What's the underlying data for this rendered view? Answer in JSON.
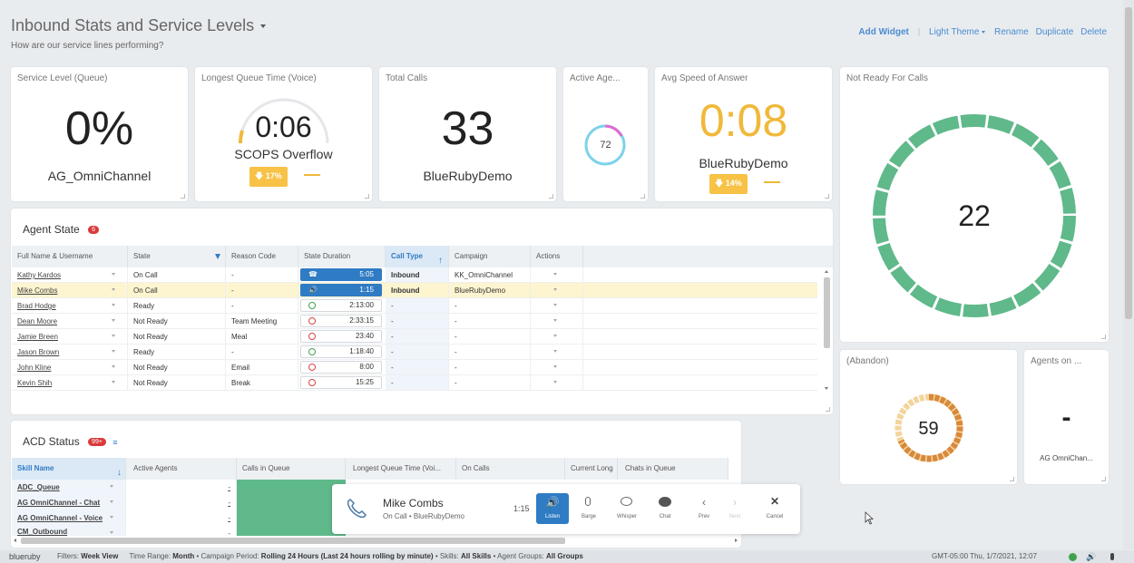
{
  "header": {
    "title": "Inbound Stats and Service Levels",
    "subtitle": "How are our service lines performing?",
    "actions": {
      "add_widget": "Add Widget",
      "theme": "Light Theme",
      "rename": "Rename",
      "duplicate": "Duplicate",
      "delete": "Delete"
    }
  },
  "widgets": {
    "service_level": {
      "title": "Service Level (Queue)",
      "value": "0%",
      "label": "AG_OmniChannel"
    },
    "longest_queue": {
      "title": "Longest Queue Time (Voice)",
      "value": "0:06",
      "label": "SCOPS Overflow",
      "trend": "17%"
    },
    "total_calls": {
      "title": "Total Calls",
      "value": "33",
      "label": "BlueRubyDemo"
    },
    "active_agents": {
      "title": "Active Age...",
      "value": "72"
    },
    "avg_speed": {
      "title": "Avg Speed of Answer",
      "value": "0:08",
      "label": "BlueRubyDemo",
      "trend": "14%"
    },
    "not_ready": {
      "title": "Not Ready For Calls",
      "value": "22"
    },
    "abandon": {
      "title": "(Abandon)",
      "value": "59"
    },
    "agents_on": {
      "title": "Agents on ...",
      "value": "-",
      "label": "AG OmniChan..."
    }
  },
  "agent_state": {
    "title": "Agent State",
    "badge": "6",
    "columns": [
      "Full Name & Username",
      "State",
      "Reason Code",
      "State Duration",
      "Call Type",
      "Campaign",
      "Actions"
    ],
    "rows": [
      {
        "name": "Kathy Kardos",
        "state": "On Call",
        "reason": "-",
        "duration": "5:05",
        "call_type": "Inbound",
        "campaign": "KK_OmniChannel",
        "icon": "phone",
        "highlight": false
      },
      {
        "name": "Mike Combs",
        "state": "On Call",
        "reason": "-",
        "duration": "1:15",
        "call_type": "Inbound",
        "campaign": "BlueRubyDemo",
        "icon": "speaker",
        "highlight": true
      },
      {
        "name": "Brad Hodge",
        "state": "Ready",
        "reason": "-",
        "duration": "2:13:00",
        "call_type": "-",
        "campaign": "-",
        "icon": "ok",
        "highlight": false
      },
      {
        "name": "Dean Moore",
        "state": "Not Ready",
        "reason": "Team Meeting",
        "duration": "2:33:15",
        "call_type": "-",
        "campaign": "-",
        "icon": "x",
        "highlight": false
      },
      {
        "name": "Jamie Breen",
        "state": "Not Ready",
        "reason": "Meal",
        "duration": "23:40",
        "call_type": "-",
        "campaign": "-",
        "icon": "x",
        "highlight": false
      },
      {
        "name": "Jason Brown",
        "state": "Ready",
        "reason": "-",
        "duration": "1:18:40",
        "call_type": "-",
        "campaign": "-",
        "icon": "ok",
        "highlight": false
      },
      {
        "name": "John Kline",
        "state": "Not Ready",
        "reason": "Email",
        "duration": "8:00",
        "call_type": "-",
        "campaign": "-",
        "icon": "x",
        "highlight": false
      },
      {
        "name": "Kevin Shih",
        "state": "Not Ready",
        "reason": "Break",
        "duration": "15:25",
        "call_type": "-",
        "campaign": "-",
        "icon": "x",
        "highlight": false
      }
    ]
  },
  "acd_status": {
    "title": "ACD Status",
    "badge": "99+",
    "columns": [
      "Skill Name",
      "Active Agents",
      "Calls in Queue",
      "Longest Queue Time (Voi...",
      "On Calls",
      "Current Long",
      "Chats in Queue"
    ],
    "rows": [
      {
        "skill": "ADC_Queue",
        "active": "-"
      },
      {
        "skill": "AG OmniChannel - Chat",
        "active": "-"
      },
      {
        "skill": "AG OmniChannel - Voice",
        "active": "-"
      },
      {
        "skill": "CM_Outbound",
        "active": "-"
      }
    ]
  },
  "call_bar": {
    "agent": "Mike Combs",
    "status": "On Call • BlueRubyDemo",
    "timer": "1:15",
    "buttons": [
      "Listen",
      "Barge",
      "Whisper",
      "Chat",
      "Prev",
      "Next",
      "Cancel"
    ]
  },
  "status_bar": {
    "brand": "blueruby",
    "filters_label": "Filters:",
    "filters_value": "Week View",
    "time_range_label": "Time Range:",
    "time_range_value": "Month",
    "campaign_label": "• Campaign Period:",
    "campaign_value": "Rolling 24 Hours (Last 24 hours rolling by minute)",
    "skills_label": "• Skills:",
    "skills_value": "All Skills",
    "groups_label": "• Agent Groups:",
    "groups_value": "All Groups",
    "datetime": "GMT-05:00 Thu, 1/7/2021, 12:07"
  },
  "colors": {
    "accent": "#2f7cc4",
    "gold": "#f0b93a",
    "green": "#5fb98a",
    "orange": "#d8893a"
  }
}
